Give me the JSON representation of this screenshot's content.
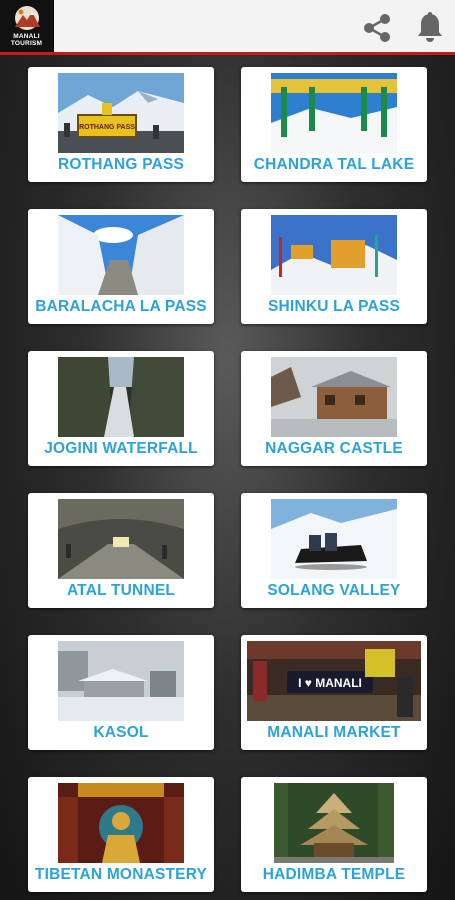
{
  "app": {
    "logo_line1": "MANALI",
    "logo_line2": "TOURISM",
    "icons": {
      "share": "share-icon",
      "notifications": "bell-icon"
    },
    "accent_color": "#c21d1d",
    "label_color": "#2ba3d8"
  },
  "places": [
    {
      "label": "ROTHANG PASS"
    },
    {
      "label": "CHANDRA TAL LAKE"
    },
    {
      "label": "BARALACHA LA PASS"
    },
    {
      "label": "SHINKU LA PASS"
    },
    {
      "label": "JOGINI  WATERFALL"
    },
    {
      "label": "NAGGAR CASTLE"
    },
    {
      "label": "ATAL TUNNEL"
    },
    {
      "label": "SOLANG VALLEY"
    },
    {
      "label": "KASOL"
    },
    {
      "label": "MANALI MARKET"
    },
    {
      "label": "TIBETAN MONASTERY"
    },
    {
      "label": "HADIMBA TEMPLE"
    }
  ],
  "signs": {
    "rothang": "ROTHANG PASS",
    "manali_market": "I ♥ MANALI"
  }
}
